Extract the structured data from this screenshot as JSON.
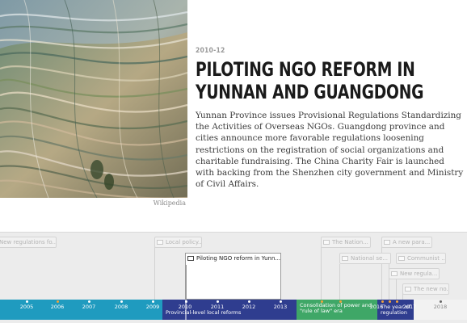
{
  "slide": {
    "date": "2010-12",
    "headline": "Piloting NGO reform in Yunnan and Guangdong",
    "body": "Yunnan Province issues Provisional Regulations Standardizing the Activities of Overseas NGOs. Guangdong province and cities announce more favorable regulations loosening restrictions on the registration of social organizations and charitable fundraising. The China Charity Fair is launched with backing from the Shenzhen city government and Ministry of Civil Affairs.",
    "media_credit": "Wikipedia",
    "media_icon": "terraced-rice-fields-photo"
  },
  "timeline": {
    "active_marker": "Piloting NGO reform in Yunn...",
    "markers": [
      {
        "label": "New regulations fo..."
      },
      {
        "label": "Local policy..."
      },
      {
        "label": "The Nation..."
      },
      {
        "label": "A new para..."
      },
      {
        "label": "National se..."
      },
      {
        "label": "Communist ..."
      },
      {
        "label": "New regula..."
      },
      {
        "label": "The new no..."
      }
    ],
    "eras": [
      {
        "label": "",
        "color": "#1f9bbf"
      },
      {
        "label": "Provincial-level local reforms",
        "color": "#2f3d8f"
      },
      {
        "label": "Consolidation of power and \"rule of law\" era",
        "color": "#3fa767"
      },
      {
        "label": "The year of regulation",
        "color": "#2f3d8f"
      }
    ],
    "years": [
      {
        "label": "2005"
      },
      {
        "label": "2006"
      },
      {
        "label": "2007"
      },
      {
        "label": "2008"
      },
      {
        "label": "2009"
      },
      {
        "label": "2010"
      },
      {
        "label": "2011"
      },
      {
        "label": "2012"
      },
      {
        "label": "2013"
      },
      {
        "label": "2016"
      },
      {
        "label": "2017"
      },
      {
        "label": "2018"
      }
    ]
  }
}
